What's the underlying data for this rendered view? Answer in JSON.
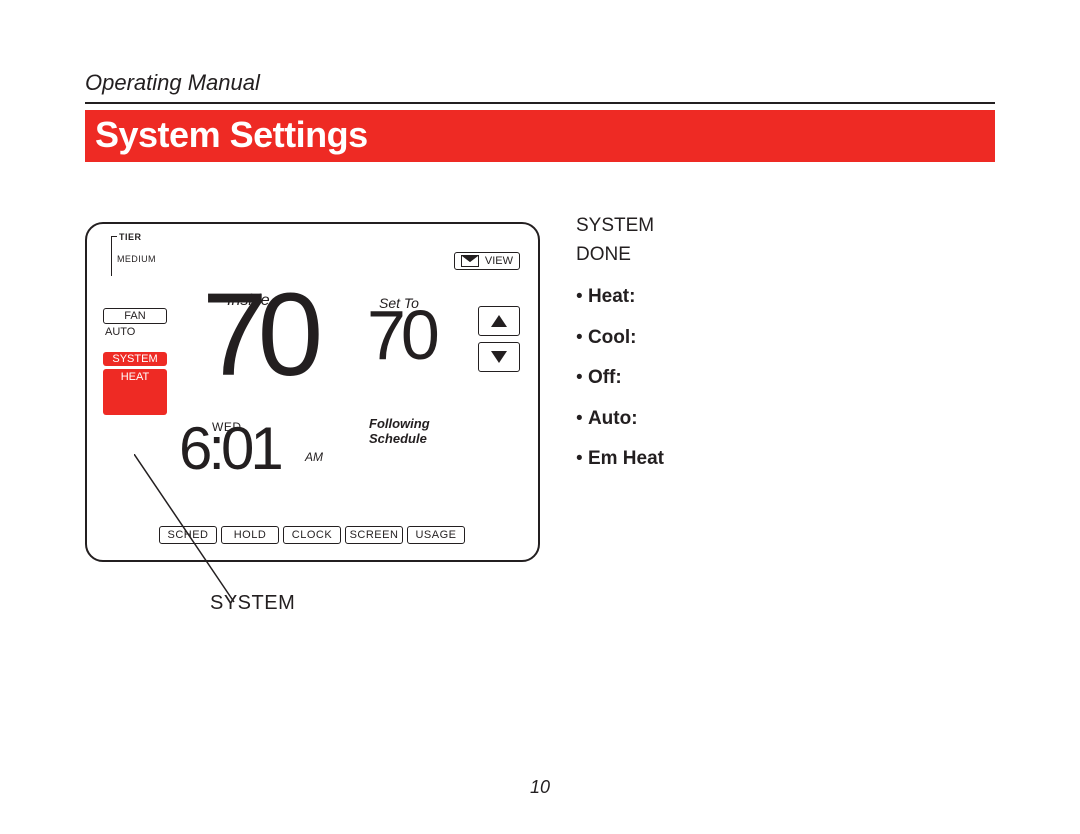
{
  "header": {
    "doc_title": "Operating Manual",
    "page_title": "System Settings",
    "page_number": "10"
  },
  "device": {
    "tier_label": "TIER",
    "tier_level": "MEDIUM",
    "fan_btn": "FAN",
    "auto_label": "AUTO",
    "system_btn": "SYSTEM",
    "heat_btn": "HEAT",
    "inside_label": "Inside",
    "inside_temp": "70",
    "set_to_label": "Set To",
    "set_temp": "70",
    "view_btn": "VIEW",
    "day": "WED",
    "time": "6:01",
    "ampm": "AM",
    "following": "Following",
    "schedule": "Schedule",
    "bottom_buttons": [
      "SCHED",
      "HOLD",
      "CLOCK",
      "SCREEN",
      "USAGE"
    ]
  },
  "callout": {
    "intro_line1": "SYSTEM",
    "intro_line2": "DONE",
    "options": [
      {
        "name": "Heat:"
      },
      {
        "name": "Cool:"
      },
      {
        "name": "Off:"
      },
      {
        "name": "Auto:"
      },
      {
        "name": "Em Heat"
      }
    ],
    "step_label": "SYSTEM"
  }
}
